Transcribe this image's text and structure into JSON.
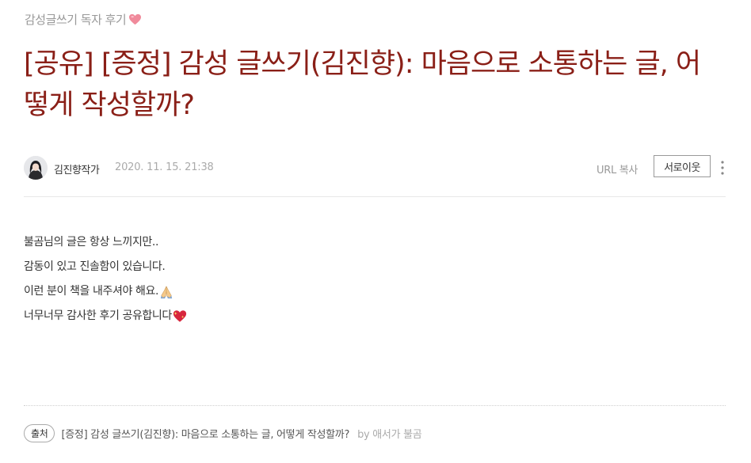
{
  "category": {
    "label": "감성글쓰기 독자 후기"
  },
  "post": {
    "title": "[공유] [증정] 감성 글쓰기(김진향): 마음으로 소통하는 글, 어떻게 작성할까?",
    "author": "김진향작가",
    "date": "2020. 11. 15. 21:38",
    "url_copy": "URL 복사",
    "neighbor_button": "서로이웃",
    "body_lines": [
      "불곰님의 글은 항상 느끼지만..",
      "감동이 있고 진솔함이 있습니다.",
      "이런 분이 책을 내주셔야 해요.",
      "너무너무 감사한 후기 공유합니다"
    ]
  },
  "source": {
    "badge": "출처",
    "link_text": "[증정] 감성 글쓰기(김진향): 마음으로 소통하는 글, 어떻게 작성할까?",
    "by": "by 애서가 불곰"
  },
  "colors": {
    "title": "#8a1f17",
    "muted": "#999999",
    "divider": "#e8e8e8"
  },
  "icons": [
    "heart-emoji",
    "folded-hands-emoji",
    "sparkling-heart-emoji",
    "more-vertical-icon",
    "avatar-photo"
  ]
}
